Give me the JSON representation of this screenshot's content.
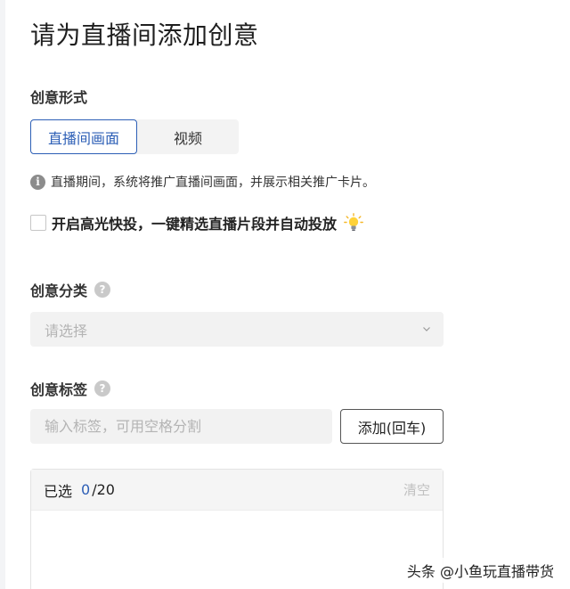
{
  "page": {
    "title": "请为直播间添加创意"
  },
  "form_type": {
    "label": "创意形式",
    "options": [
      "直播间画面",
      "视频"
    ],
    "selected": "直播间画面",
    "info": "直播期间，系统将推广直播间画面，并展示相关推广卡片。"
  },
  "highlight": {
    "checked": false,
    "label": "开启高光快投，一键精选直播片段并自动投放"
  },
  "category": {
    "label": "创意分类",
    "placeholder": "请选择"
  },
  "tags": {
    "label": "创意标签",
    "placeholder": "输入标签，可用空格分割",
    "add_label": "添加(回车)",
    "selected_label": "已选",
    "selected_count": "0",
    "selected_total": "/20",
    "clear_label": "清空"
  },
  "watermark": "头条 @小鱼玩直播带货",
  "colors": {
    "accent": "#2d5fb6",
    "input_bg": "#f2f2f2"
  },
  "icons": [
    "info-icon",
    "lightbulb-icon",
    "help-icon",
    "chevron-down-icon"
  ]
}
